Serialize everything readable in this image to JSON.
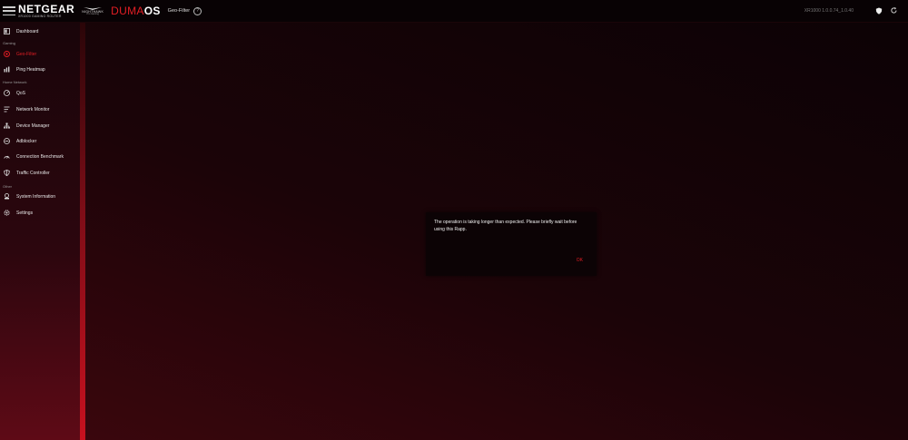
{
  "header": {
    "brand_name": "NETGEAR",
    "brand_sub": "XR1000 GAMING ROUTER",
    "nighthawk_name": "NIGHTHAWK",
    "nighthawk_sub": "Pro Gaming",
    "duma_a": "DUMA",
    "duma_b": "OS",
    "page_title": "Geo-Filter",
    "help": "?",
    "version": "XR1000 1.0.0.74_1.0.40"
  },
  "sidebar": {
    "sections": {
      "gaming": "Gaming",
      "home_network": "Home Network",
      "other": "Other"
    },
    "items": [
      {
        "label": "Dashboard",
        "icon": "dashboard-icon"
      },
      {
        "label": "Geo-Filter",
        "icon": "geo-filter-icon",
        "active": true
      },
      {
        "label": "Ping Heatmap",
        "icon": "ping-heatmap-icon"
      },
      {
        "label": "QoS",
        "icon": "qos-icon"
      },
      {
        "label": "Network Monitor",
        "icon": "network-monitor-icon"
      },
      {
        "label": "Device Manager",
        "icon": "device-manager-icon"
      },
      {
        "label": "Adblocker",
        "icon": "adblocker-icon"
      },
      {
        "label": "Connection Benchmark",
        "icon": "benchmark-icon"
      },
      {
        "label": "Traffic Controller",
        "icon": "traffic-controller-icon"
      },
      {
        "label": "System Information",
        "icon": "system-info-icon"
      },
      {
        "label": "Settings",
        "icon": "settings-icon"
      }
    ]
  },
  "dialog": {
    "message": "The operation is taking longer than expected. Please briefly wait before using this Rapp.",
    "ok_label": "OK"
  },
  "colors": {
    "accent": "#e31e24",
    "background": "#0d0204"
  }
}
